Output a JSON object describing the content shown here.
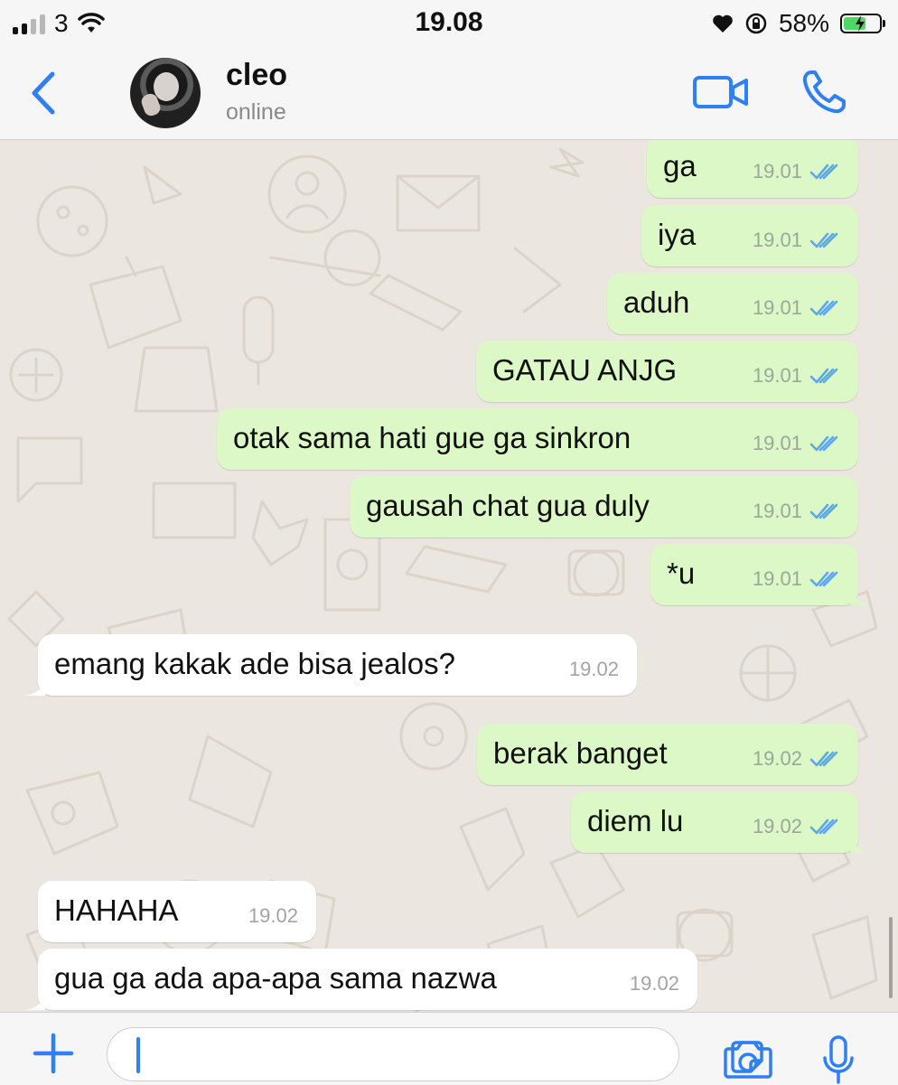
{
  "status_bar": {
    "carrier": "3",
    "time": "19.08",
    "battery": "58%"
  },
  "header": {
    "contact_name": "cleo",
    "contact_status": "online"
  },
  "messages": [
    {
      "text": "ga",
      "time": "19.01",
      "dir": "out"
    },
    {
      "text": "iya",
      "time": "19.01",
      "dir": "out"
    },
    {
      "text": "aduh",
      "time": "19.01",
      "dir": "out"
    },
    {
      "text": "GATAU ANJG",
      "time": "19.01",
      "dir": "out"
    },
    {
      "text": "otak sama hati gue ga sinkron",
      "time": "19.01",
      "dir": "out"
    },
    {
      "text": "gausah chat gua duly",
      "time": "19.01",
      "dir": "out"
    },
    {
      "text": "*u",
      "time": "19.01",
      "dir": "out"
    },
    {
      "text": "emang kakak ade bisa jealos?",
      "time": "19.02",
      "dir": "in"
    },
    {
      "text": "berak banget",
      "time": "19.02",
      "dir": "out"
    },
    {
      "text": "diem lu",
      "time": "19.02",
      "dir": "out"
    },
    {
      "text": "HAHAHA",
      "time": "19.02",
      "dir": "in"
    },
    {
      "text": "gua ga ada apa-apa sama nazwa",
      "time": "19.02",
      "dir": "in"
    }
  ],
  "colors": {
    "accent": "#2f7ff5",
    "outgoing_bubble": "#dcf8c6",
    "incoming_bubble": "#ffffff",
    "chat_background": "#ebe6df",
    "read_ticks": "#5aa6f0"
  },
  "icons": {
    "back": "chevron-left-icon",
    "video": "video-camera-icon",
    "call": "phone-icon",
    "attach": "plus-icon",
    "sticker": "sticker-icon",
    "camera": "camera-icon",
    "mic": "microphone-icon"
  }
}
